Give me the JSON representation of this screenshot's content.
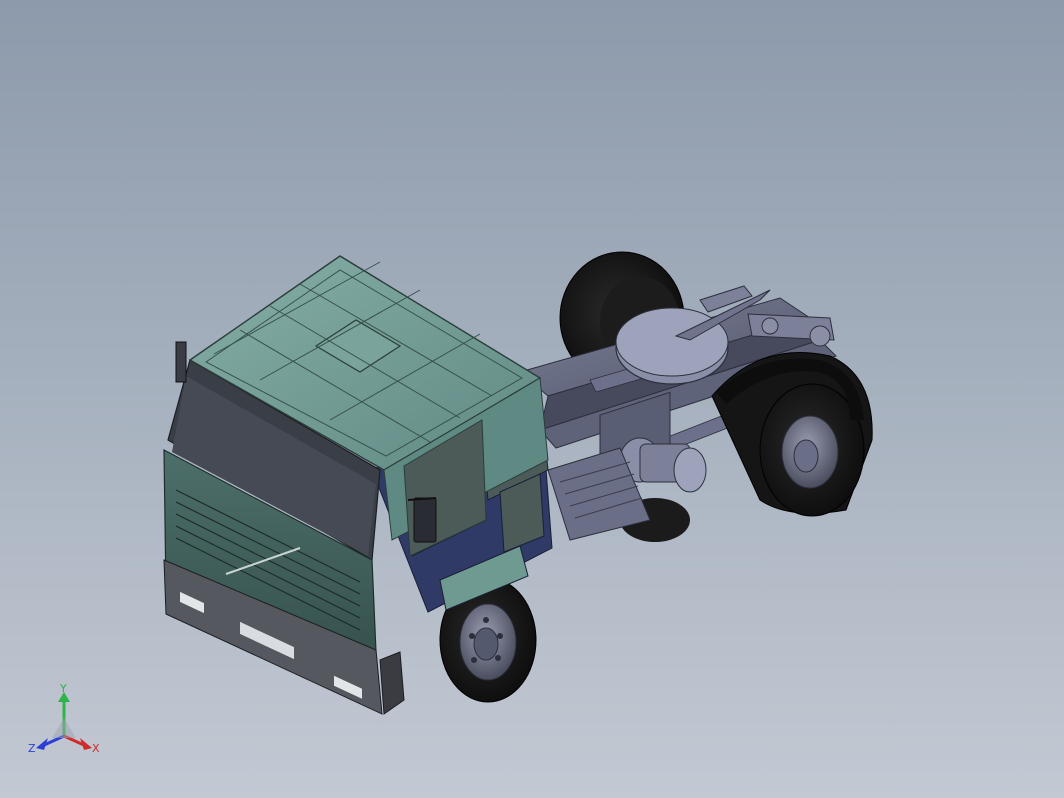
{
  "viewport": {
    "background_top": "#8d9aab",
    "background_bottom": "#c3c9d3"
  },
  "model": {
    "cab_color": "#6f9a92",
    "cab_dark": "#3f5e5a",
    "door_color": "#2f3a66",
    "chassis_color": "#6a6e86",
    "tire_color": "#151515",
    "fifth_wheel_color": "#8a8fa8"
  },
  "triad": {
    "y_label": "Y",
    "x_label": "X",
    "z_label": "Z",
    "y_color": "#2fb34a",
    "x_color": "#d02a2a",
    "z_color": "#2b3fd6"
  }
}
